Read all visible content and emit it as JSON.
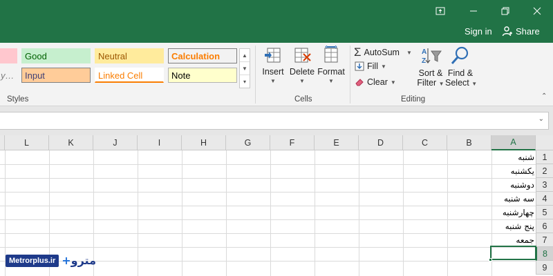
{
  "window": {
    "signin_label": "Sign in",
    "share_label": "Share",
    "accent_color": "#217346"
  },
  "ribbon": {
    "styles_group": {
      "label": "Styles",
      "cells": [
        {
          "name": "good",
          "label": "Good",
          "bg": "#c6efce",
          "fg": "#006100"
        },
        {
          "name": "neutral",
          "label": "Neutral",
          "bg": "#ffeb9c",
          "fg": "#9c5700"
        },
        {
          "name": "calculation",
          "label": "Calculation",
          "bg": "#f2f2f2",
          "fg": "#fa7d00"
        },
        {
          "name": "input",
          "label": "Input",
          "bg": "#ffcc99",
          "fg": "#3f3f76"
        },
        {
          "name": "linked-cell",
          "label": "Linked Cell",
          "bg": "#ffffff",
          "fg": "#fa7d00"
        },
        {
          "name": "note",
          "label": "Note",
          "bg": "#ffffcc",
          "fg": "#000000"
        }
      ]
    },
    "cells_group": {
      "label": "Cells",
      "insert_label": "Insert",
      "delete_label": "Delete",
      "format_label": "Format"
    },
    "editing_group": {
      "label": "Editing",
      "autosum_label": "AutoSum",
      "fill_label": "Fill",
      "clear_label": "Clear",
      "sort_filter_line1": "Sort &",
      "sort_filter_line2": "Filter",
      "find_select_line1": "Find &",
      "find_select_line2": "Select"
    }
  },
  "sheet": {
    "columns": [
      "L",
      "K",
      "J",
      "I",
      "H",
      "G",
      "F",
      "E",
      "D",
      "C",
      "B",
      "A"
    ],
    "selected_column": "A",
    "rows": [
      "1",
      "2",
      "3",
      "4",
      "5",
      "6",
      "7",
      "8",
      "9"
    ],
    "selected_row": "8",
    "column_a_values": [
      "شنبه",
      "یکشنبه",
      "دوشنبه",
      "سه شنبه",
      "چهارشنبه",
      "پنج شنبه",
      "جمعه",
      "",
      ""
    ]
  },
  "watermark": {
    "site": "Metrorplus.ir",
    "logo_text": "مترو"
  }
}
